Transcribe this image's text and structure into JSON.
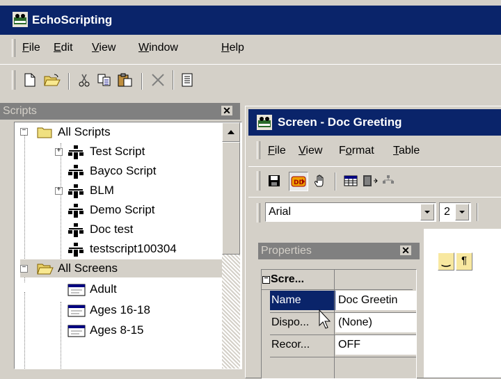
{
  "app": {
    "title": "EchoScripting"
  },
  "menu": {
    "file": {
      "pre": "",
      "u": "F",
      "post": "ile"
    },
    "edit": {
      "pre": "",
      "u": "E",
      "post": "dit"
    },
    "view": {
      "pre": "",
      "u": "V",
      "post": "iew"
    },
    "window": {
      "pre": "",
      "u": "W",
      "post": "indow"
    },
    "help": {
      "pre": "",
      "u": "H",
      "post": "elp"
    }
  },
  "scripts_panel": {
    "title": "Scripts",
    "items": [
      {
        "label": "All Scripts"
      },
      {
        "label": "Test Script"
      },
      {
        "label": "Bayco Script"
      },
      {
        "label": "BLM"
      },
      {
        "label": "Demo Script"
      },
      {
        "label": "Doc test"
      },
      {
        "label": "testscript100304"
      },
      {
        "label": "All Screens"
      },
      {
        "label": "Adult"
      },
      {
        "label": "Ages 16-18"
      },
      {
        "label": "Ages 8-15"
      }
    ]
  },
  "screen_window": {
    "title": "Screen - Doc Greeting",
    "menu": {
      "file": {
        "pre": "",
        "u": "F",
        "post": "ile"
      },
      "view": {
        "pre": "",
        "u": "V",
        "post": "iew"
      },
      "format": {
        "pre": "F",
        "u": "o",
        "post": "rmat"
      },
      "table": {
        "pre": "",
        "u": "T",
        "post": "able"
      }
    },
    "font_select": "Arial",
    "size_select": "2"
  },
  "properties_panel": {
    "title": "Properties",
    "category": "Scre...",
    "rows": [
      {
        "name": "Name",
        "value": "Doc Greetin"
      },
      {
        "name": "Dispo...",
        "value": "(None)"
      },
      {
        "name": "Recor...",
        "value": "OFF"
      }
    ]
  },
  "colors": {
    "titlebar": "#0a246a",
    "face": "#d4d0c8",
    "selected": "#0a246a"
  }
}
